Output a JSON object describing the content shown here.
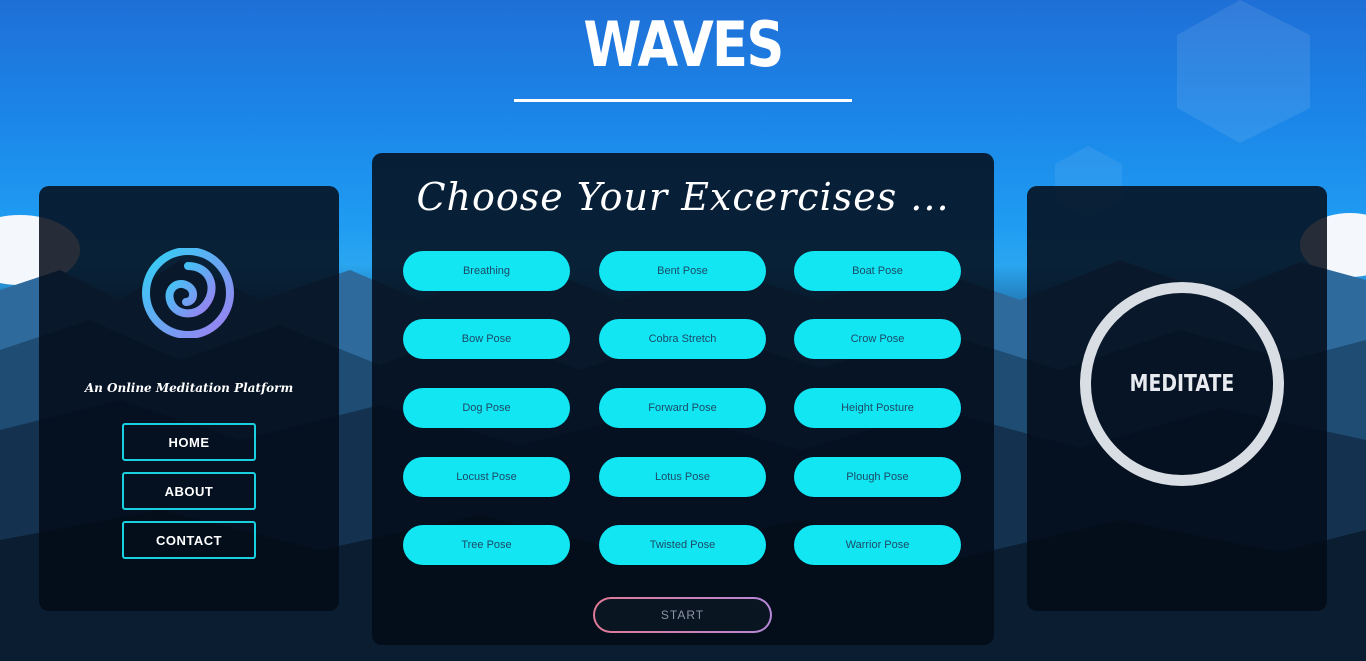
{
  "header": {
    "title": "WAVES"
  },
  "sidebar": {
    "tagline": "An Online Meditation Platform",
    "nav": [
      "HOME",
      "ABOUT",
      "CONTACT"
    ]
  },
  "main": {
    "heading": "Choose Your Excercises ...",
    "poses": [
      "Breathing",
      "Bent Pose",
      "Boat Pose",
      "Bow Pose",
      "Cobra Stretch",
      "Crow Pose",
      "Dog Pose",
      "Forward Pose",
      "Height Posture",
      "Locust Pose",
      "Lotus Pose",
      "Plough Pose",
      "Tree Pose",
      "Twisted Pose",
      "Warrior Pose"
    ],
    "start_label": "START"
  },
  "meditate": {
    "label": "MEDITATE"
  },
  "colors": {
    "accent": "#12e6f3",
    "nav_border": "#18d0e0",
    "ring": "#d9dde4"
  }
}
